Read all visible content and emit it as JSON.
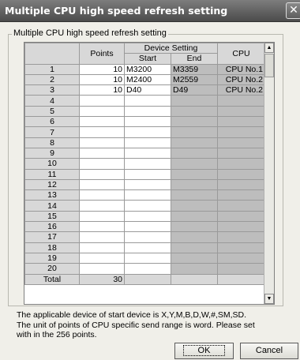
{
  "window": {
    "title": "Multiple CPU high speed refresh setting",
    "close_glyph": "✕"
  },
  "group": {
    "label": "Multiple CPU high speed refresh setting"
  },
  "grid": {
    "header_points": "Points",
    "header_device_setting": "Device Setting",
    "header_start": "Start",
    "header_end": "End",
    "header_cpu": "CPU",
    "rows": [
      {
        "no": "1",
        "points": "10",
        "start": "M3200",
        "end": "M3359",
        "cpu": "CPU No.1"
      },
      {
        "no": "2",
        "points": "10",
        "start": "M2400",
        "end": "M2559",
        "cpu": "CPU No.2"
      },
      {
        "no": "3",
        "points": "10",
        "start": "D40",
        "end": "D49",
        "cpu": "CPU No.2"
      },
      {
        "no": "4",
        "points": "",
        "start": "",
        "end": "",
        "cpu": ""
      },
      {
        "no": "5",
        "points": "",
        "start": "",
        "end": "",
        "cpu": ""
      },
      {
        "no": "6",
        "points": "",
        "start": "",
        "end": "",
        "cpu": ""
      },
      {
        "no": "7",
        "points": "",
        "start": "",
        "end": "",
        "cpu": ""
      },
      {
        "no": "8",
        "points": "",
        "start": "",
        "end": "",
        "cpu": ""
      },
      {
        "no": "9",
        "points": "",
        "start": "",
        "end": "",
        "cpu": ""
      },
      {
        "no": "10",
        "points": "",
        "start": "",
        "end": "",
        "cpu": ""
      },
      {
        "no": "11",
        "points": "",
        "start": "",
        "end": "",
        "cpu": ""
      },
      {
        "no": "12",
        "points": "",
        "start": "",
        "end": "",
        "cpu": ""
      },
      {
        "no": "13",
        "points": "",
        "start": "",
        "end": "",
        "cpu": ""
      },
      {
        "no": "14",
        "points": "",
        "start": "",
        "end": "",
        "cpu": ""
      },
      {
        "no": "15",
        "points": "",
        "start": "",
        "end": "",
        "cpu": ""
      },
      {
        "no": "16",
        "points": "",
        "start": "",
        "end": "",
        "cpu": ""
      },
      {
        "no": "17",
        "points": "",
        "start": "",
        "end": "",
        "cpu": ""
      },
      {
        "no": "18",
        "points": "",
        "start": "",
        "end": "",
        "cpu": ""
      },
      {
        "no": "19",
        "points": "",
        "start": "",
        "end": "",
        "cpu": ""
      },
      {
        "no": "20",
        "points": "",
        "start": "",
        "end": "",
        "cpu": ""
      }
    ],
    "total_label": "Total",
    "total_points": "30"
  },
  "scrollbar": {
    "up_glyph": "▲",
    "down_glyph": "▼"
  },
  "note": {
    "line1": "The applicable device of start device is X,Y,M,B,D,W,#,SM,SD.",
    "line2": "The unit of points of CPU specific send range is word. Please set",
    "line3": "with in the 256 points."
  },
  "buttons": {
    "ok": "OK",
    "cancel": "Cancel"
  }
}
